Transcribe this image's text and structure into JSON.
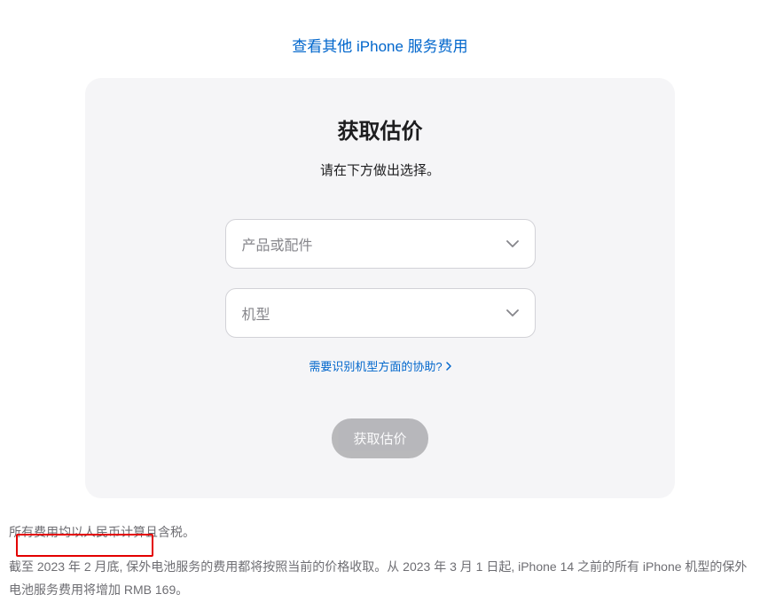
{
  "topLink": {
    "label": "查看其他 iPhone 服务费用"
  },
  "card": {
    "title": "获取估价",
    "subtitle": "请在下方做出选择。",
    "select1": {
      "placeholder": "产品或配件"
    },
    "select2": {
      "placeholder": "机型"
    },
    "helpLink": "需要识别机型方面的协助?",
    "submitLabel": "获取估价"
  },
  "footer": {
    "line1": "所有费用均以人民币计算且含税。",
    "line2": "截至 2023 年 2 月底, 保外电池服务的费用都将按照当前的价格收取。从 2023 年 3 月 1 日起, iPhone 14 之前的所有 iPhone 机型的保外电池服务费用将增加 RMB 169。"
  }
}
